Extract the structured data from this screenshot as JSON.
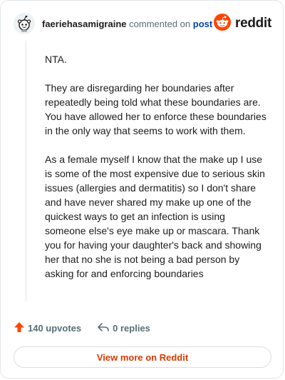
{
  "header": {
    "username": "faeriehasamigraine",
    "verb": "commented on",
    "post_link": "post",
    "brand": "reddit",
    "avatar_icon": "snoo-avatar-icon",
    "brand_icon": "reddit-logo-icon"
  },
  "comment": {
    "paragraphs": [
      "NTA.",
      "They are disregarding her boundaries after repeatedly being told what these boundaries are. You have allowed her to enforce these boundaries in the only way that seems to work with them.",
      "As a female myself I know that the make up I use is some of the most expensive due to serious skin issues (allergies and dermatitis) so I don't share and have never shared my make up one of the quickest ways to get an infection is using someone else's eye make up or mascara. Thank you for having your daughter's back and showing her that no she is not being a bad person by asking for and enforcing boundaries"
    ]
  },
  "actions": {
    "upvotes": "140 upvotes",
    "replies": "0 replies",
    "upvote_icon": "upvote-arrow-icon",
    "reply_icon": "reply-arrow-icon"
  },
  "cta": {
    "label": "View more on Reddit"
  },
  "colors": {
    "accent": "#ff4500",
    "link": "#0045ac",
    "cta_text": "#d93a00",
    "muted": "#576f76"
  }
}
